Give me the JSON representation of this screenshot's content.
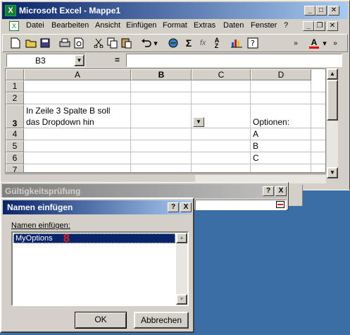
{
  "excel": {
    "title": "Microsoft Excel - Mappe1",
    "menu": [
      "Datei",
      "Bearbeiten",
      "Ansicht",
      "Einfügen",
      "Format",
      "Extras",
      "Daten",
      "Fenster",
      "?"
    ],
    "name_box": "B3",
    "formula_equals": "=",
    "columns": [
      "A",
      "B",
      "C",
      "D"
    ],
    "rows": [
      "1",
      "2",
      "3",
      "4",
      "5",
      "6",
      "7"
    ],
    "cell_a3_line1": "In Zeile 3 Spalte B soll",
    "cell_a3_line2": "das Dropdown hin",
    "cell_d3": "Optionen:",
    "cell_d4": "A",
    "cell_d5": "B",
    "cell_d6": "C"
  },
  "validation_dialog": {
    "title": "Gültigkeitsprüfung",
    "help": "?",
    "close": "X"
  },
  "names_dialog": {
    "title": "Namen einfügen",
    "help": "?",
    "close": "X",
    "label": "Namen einfügen:",
    "items": [
      "MyOptions"
    ],
    "annotation": "8",
    "ok": "OK",
    "cancel": "Abbrechen"
  },
  "colors": {
    "desktop": "#3a6ea5",
    "titlebar_active": "#0a246a",
    "selection": "#0a246a",
    "annotation": "#e02020",
    "face": "#d4d0c8"
  }
}
